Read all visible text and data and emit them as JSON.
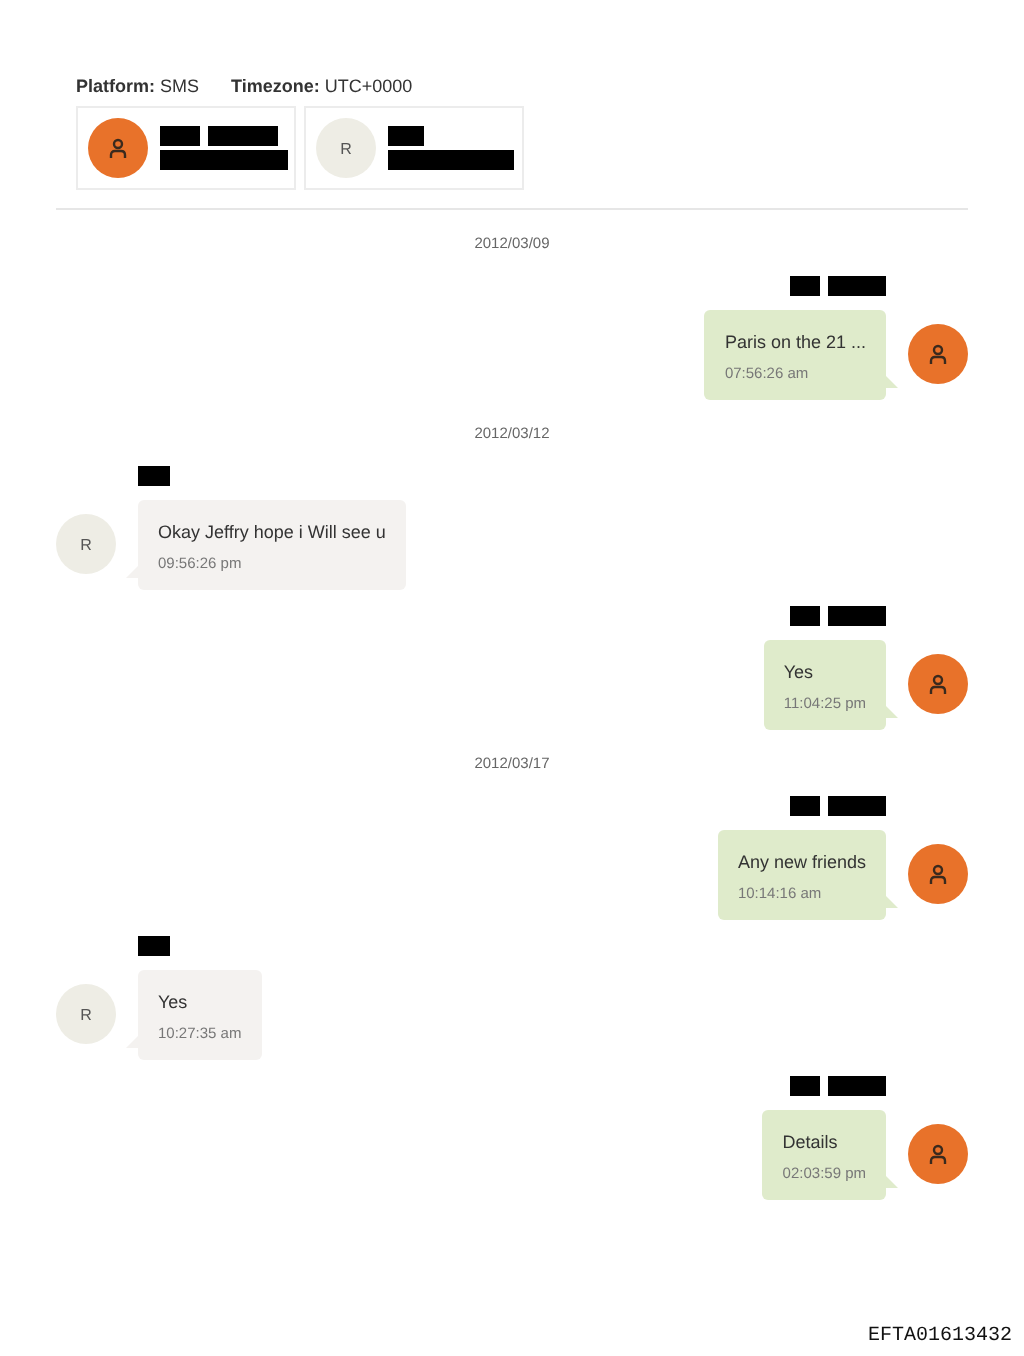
{
  "header": {
    "platform_label": "Platform:",
    "platform": "SMS",
    "timezone_label": "Timezone:",
    "timezone": "UTC+0000"
  },
  "participants": [
    {
      "kind": "owner",
      "name_redacted": true
    },
    {
      "kind": "contact",
      "initial": "R",
      "name_redacted": true
    }
  ],
  "messages": [
    {
      "kind": "date",
      "text": "2012/03/09"
    },
    {
      "kind": "outgoing",
      "sender_redacted": true,
      "text": "Paris on the 21 ...",
      "time": "07:56:26 am"
    },
    {
      "kind": "date",
      "text": "2012/03/12"
    },
    {
      "kind": "incoming",
      "initial": "R",
      "sender_redacted": true,
      "text": "Okay Jeffry hope i Will see u",
      "time": "09:56:26 pm"
    },
    {
      "kind": "outgoing",
      "sender_redacted": true,
      "text": "Yes",
      "time": "11:04:25 pm"
    },
    {
      "kind": "date",
      "text": "2012/03/17"
    },
    {
      "kind": "outgoing",
      "sender_redacted": true,
      "text": "Any new friends",
      "time": "10:14:16 am"
    },
    {
      "kind": "incoming",
      "initial": "R",
      "sender_redacted": true,
      "text": "Yes",
      "time": "10:27:35 am"
    },
    {
      "kind": "outgoing",
      "sender_redacted": true,
      "text": "Details",
      "time": "02:03:59 pm"
    }
  ],
  "footer": {
    "stamp": "EFTA01613432"
  }
}
